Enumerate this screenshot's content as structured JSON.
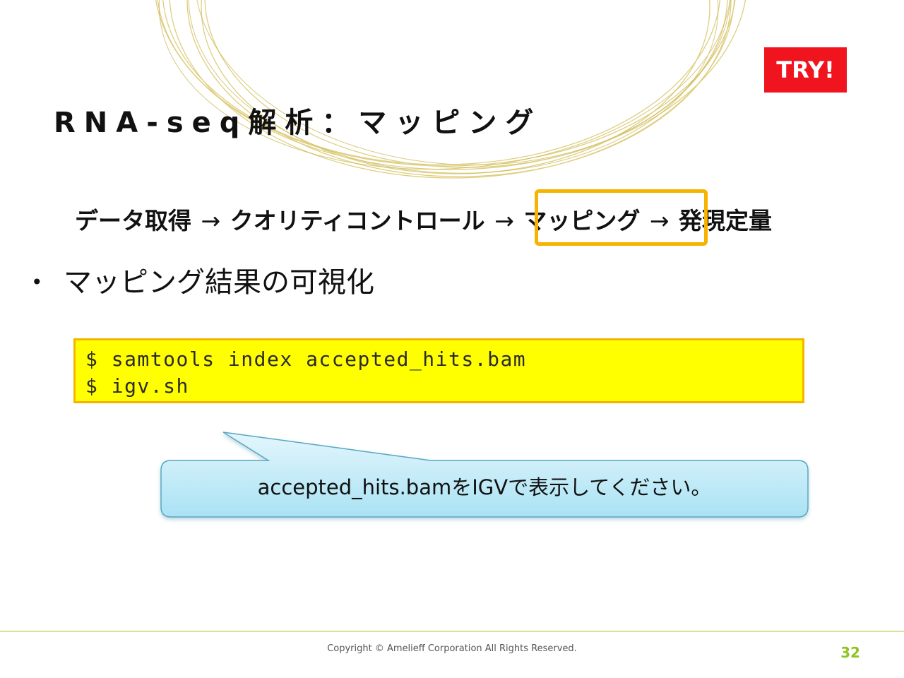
{
  "badge": {
    "label": "TRY!",
    "color": "#f0141e"
  },
  "slide": {
    "title": "RNA-seq解析：マッピング"
  },
  "workflow": {
    "steps": [
      "データ取得",
      "クオリティコントロール",
      "マッピング",
      "発現定量"
    ],
    "arrow": "→",
    "highlighted_step": "マッピング",
    "highlight_color": "#f6b400"
  },
  "bullets": [
    {
      "marker": "•",
      "text": "マッピング結果の可視化"
    }
  ],
  "code": {
    "lines": [
      "$ samtools index accepted_hits.bam",
      "$ igv.sh"
    ],
    "background": "#ffff00"
  },
  "callout": {
    "text": "accepted_hits.bamをIGVで表示してください。"
  },
  "footer": {
    "copyright": "Copyright © Amelieff Corporation All Rights Reserved.",
    "page_number": "32",
    "accent_color": "#8fc31f"
  }
}
